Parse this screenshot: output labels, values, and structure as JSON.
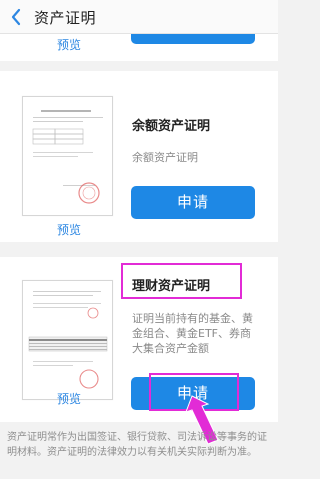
{
  "header": {
    "title": "资产证明"
  },
  "cards": [
    {
      "preview_label": "预览"
    },
    {
      "title": "余额资产证明",
      "description": "余额资产证明",
      "apply_label": "申请",
      "preview_label": "预览"
    },
    {
      "title": "理财资产证明",
      "description": "证明当前持有的基金、黄金组合、黄金ETF、券商大集合资产金额",
      "apply_label": "申请",
      "preview_label": "预览"
    }
  ],
  "footer_note": "资产证明常作为出国签证、银行贷款、司法诉讼等事务的证明材料。资产证明的法律效力以有关机关实际判断为准。",
  "colors": {
    "accent": "#1e88e5",
    "link": "#2d87e2",
    "annotation": "#e22bd6"
  },
  "icons": [
    "back-arrow-icon",
    "document-thumbnail",
    "annotation-arrow-icon"
  ]
}
